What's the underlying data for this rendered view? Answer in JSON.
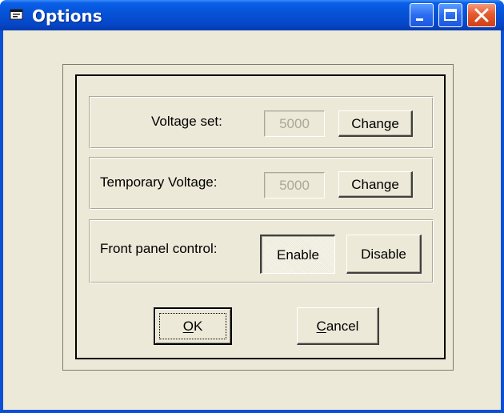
{
  "window": {
    "title": "Options",
    "icon": "app-window-icon",
    "controls": [
      "minimize-icon",
      "maximize-icon",
      "close-icon"
    ]
  },
  "voltage_set": {
    "label": "Voltage set:",
    "value": "5000",
    "button": "Change"
  },
  "temporary_voltage": {
    "label": "Temporary Voltage:",
    "value": "5000",
    "button": "Change"
  },
  "front_panel": {
    "label": "Front panel control:",
    "enable": "Enable",
    "disable": "Disable",
    "selected": "Enable"
  },
  "footer": {
    "ok": "OK",
    "ok_mnemonic": "O",
    "cancel": "Cancel",
    "cancel_mnemonic": "C"
  },
  "colors": {
    "titlebar": "#0552d6",
    "face": "#ece9d8",
    "close_button": "#e65a30"
  }
}
